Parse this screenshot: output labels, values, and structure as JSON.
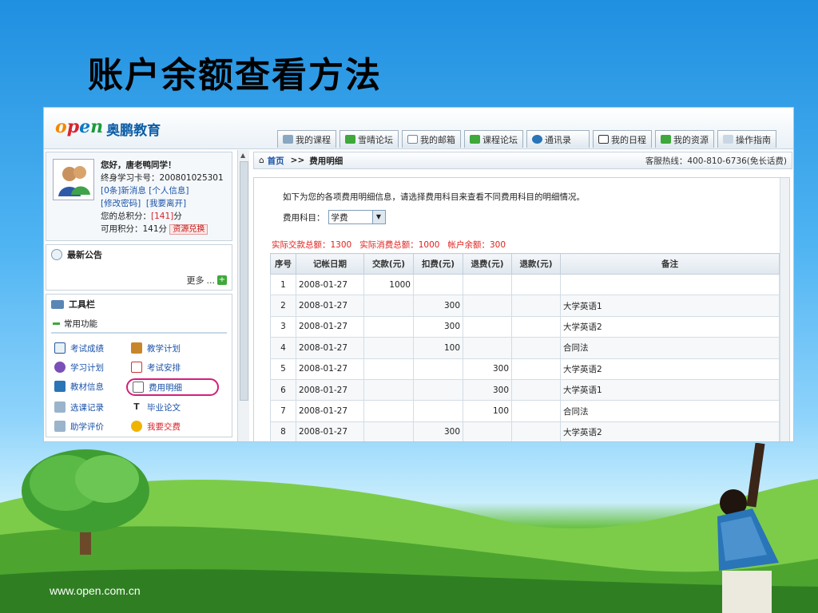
{
  "slide": {
    "title": "账户余额查看方法",
    "footer_url": "www.open.com.cn"
  },
  "app": {
    "logo_mark": "open",
    "logo_text": "奥鹏教育",
    "tabs": [
      "我的课程",
      "雪晴论坛",
      "我的邮箱",
      "课程论坛",
      "通讯录",
      "我的日程",
      "我的资源",
      "操作指南"
    ]
  },
  "user": {
    "greeting": "您好，唐老鸭同学！",
    "card_label": "终身学习卡号：",
    "card_no": "200801025301",
    "msg_link": "[0条]新消息",
    "info_link": "[个人信息]",
    "pwd_link": "[修改密码]",
    "leave_link": "[我要离开]",
    "total_label": "您的总积分：",
    "total_value": "[141]",
    "total_unit": "分",
    "avail_label": "可用积分：141分",
    "exchange_btn": "资源兑换"
  },
  "notice": {
    "title": "最新公告",
    "more": "更多"
  },
  "toolbar": {
    "title": "工具栏",
    "section": "常用功能",
    "items": [
      {
        "label": "考试成绩"
      },
      {
        "label": "教学计划"
      },
      {
        "label": "学习计划"
      },
      {
        "label": "考试安排"
      },
      {
        "label": "教材信息"
      },
      {
        "label": "费用明细"
      },
      {
        "label": "选课记录"
      },
      {
        "label": "毕业论文"
      },
      {
        "label": "助学评价"
      },
      {
        "label": "我要交费"
      }
    ]
  },
  "breadcrumb": {
    "home": "首页",
    "sep": ">>",
    "current": "费用明细",
    "hotline": "客服热线：400-810-6736(免长话费)"
  },
  "content": {
    "intro": "如下为您的各项费用明细信息，请选择费用科目来查看不同费用科目的明细情况。",
    "subject_label": "费用科目：",
    "subject_value": "学费",
    "summary": "实际交款总额：1300   实际消费总额：1000   帐户余额：300"
  },
  "table": {
    "headers": [
      "序号",
      "记帐日期",
      "交款(元)",
      "扣费(元)",
      "退费(元)",
      "退款(元)",
      "备注"
    ],
    "rows": [
      [
        "1",
        "2008-01-27",
        "1000",
        "",
        "",
        "",
        ""
      ],
      [
        "2",
        "2008-01-27",
        "",
        "300",
        "",
        "",
        "大学英语1"
      ],
      [
        "3",
        "2008-01-27",
        "",
        "300",
        "",
        "",
        "大学英语2"
      ],
      [
        "4",
        "2008-01-27",
        "",
        "100",
        "",
        "",
        "合同法"
      ],
      [
        "5",
        "2008-01-27",
        "",
        "",
        "300",
        "",
        "大学英语2"
      ],
      [
        "6",
        "2008-01-27",
        "",
        "",
        "300",
        "",
        "大学英语1"
      ],
      [
        "7",
        "2008-01-27",
        "",
        "",
        "100",
        "",
        "合同法"
      ],
      [
        "8",
        "2008-01-27",
        "",
        "300",
        "",
        "",
        "大学英语2"
      ]
    ]
  },
  "colors": {
    "accent_red": "#d8232a",
    "link_blue": "#1a52a8",
    "highlight_circle": "#d61d7b"
  }
}
